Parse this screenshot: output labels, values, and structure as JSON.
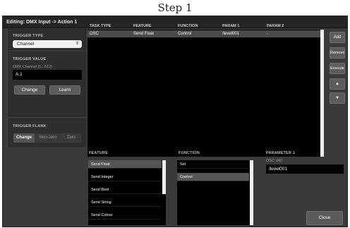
{
  "caption": "Step 1",
  "window": {
    "title": "Editing: DMX Input -> Action 1"
  },
  "trigger_type": {
    "label": "TRIGGER TYPE",
    "value": "Channel"
  },
  "trigger_value": {
    "label": "TRIGGER VALUE",
    "sublabel": "DMX Channel [1...512]",
    "value": "A.1",
    "change_label": "Change",
    "learn_label": "Learn"
  },
  "trigger_flank": {
    "label": "TRIGGER FLANK",
    "options": [
      "Change",
      "Non-zero",
      "Zero"
    ],
    "selected": "Change"
  },
  "actions_table": {
    "columns": [
      "TASK TYPE",
      "FEATURE",
      "FUNCTION",
      "PARAM 1",
      "PARAM 2"
    ],
    "rows": [
      [
        "OSC",
        "Send Float",
        "Control",
        "/level001",
        "-"
      ]
    ]
  },
  "side_buttons": {
    "add": "Add",
    "remove": "Remove",
    "execute": "Execute",
    "up": "▲",
    "down": "▼"
  },
  "feature": {
    "label": "FEATURE",
    "items": [
      "Send Float",
      "Send Integer",
      "Send Bool",
      "Send String",
      "Send Colour"
    ],
    "selected_index": 0
  },
  "function": {
    "label": "FUNCTION",
    "items": [
      "Set",
      "Control"
    ],
    "selected_index": 1
  },
  "parameter": {
    "label": "PARAMETER 1",
    "sublabel": "OSC URI",
    "value": "/level001"
  },
  "close_label": "Close"
}
